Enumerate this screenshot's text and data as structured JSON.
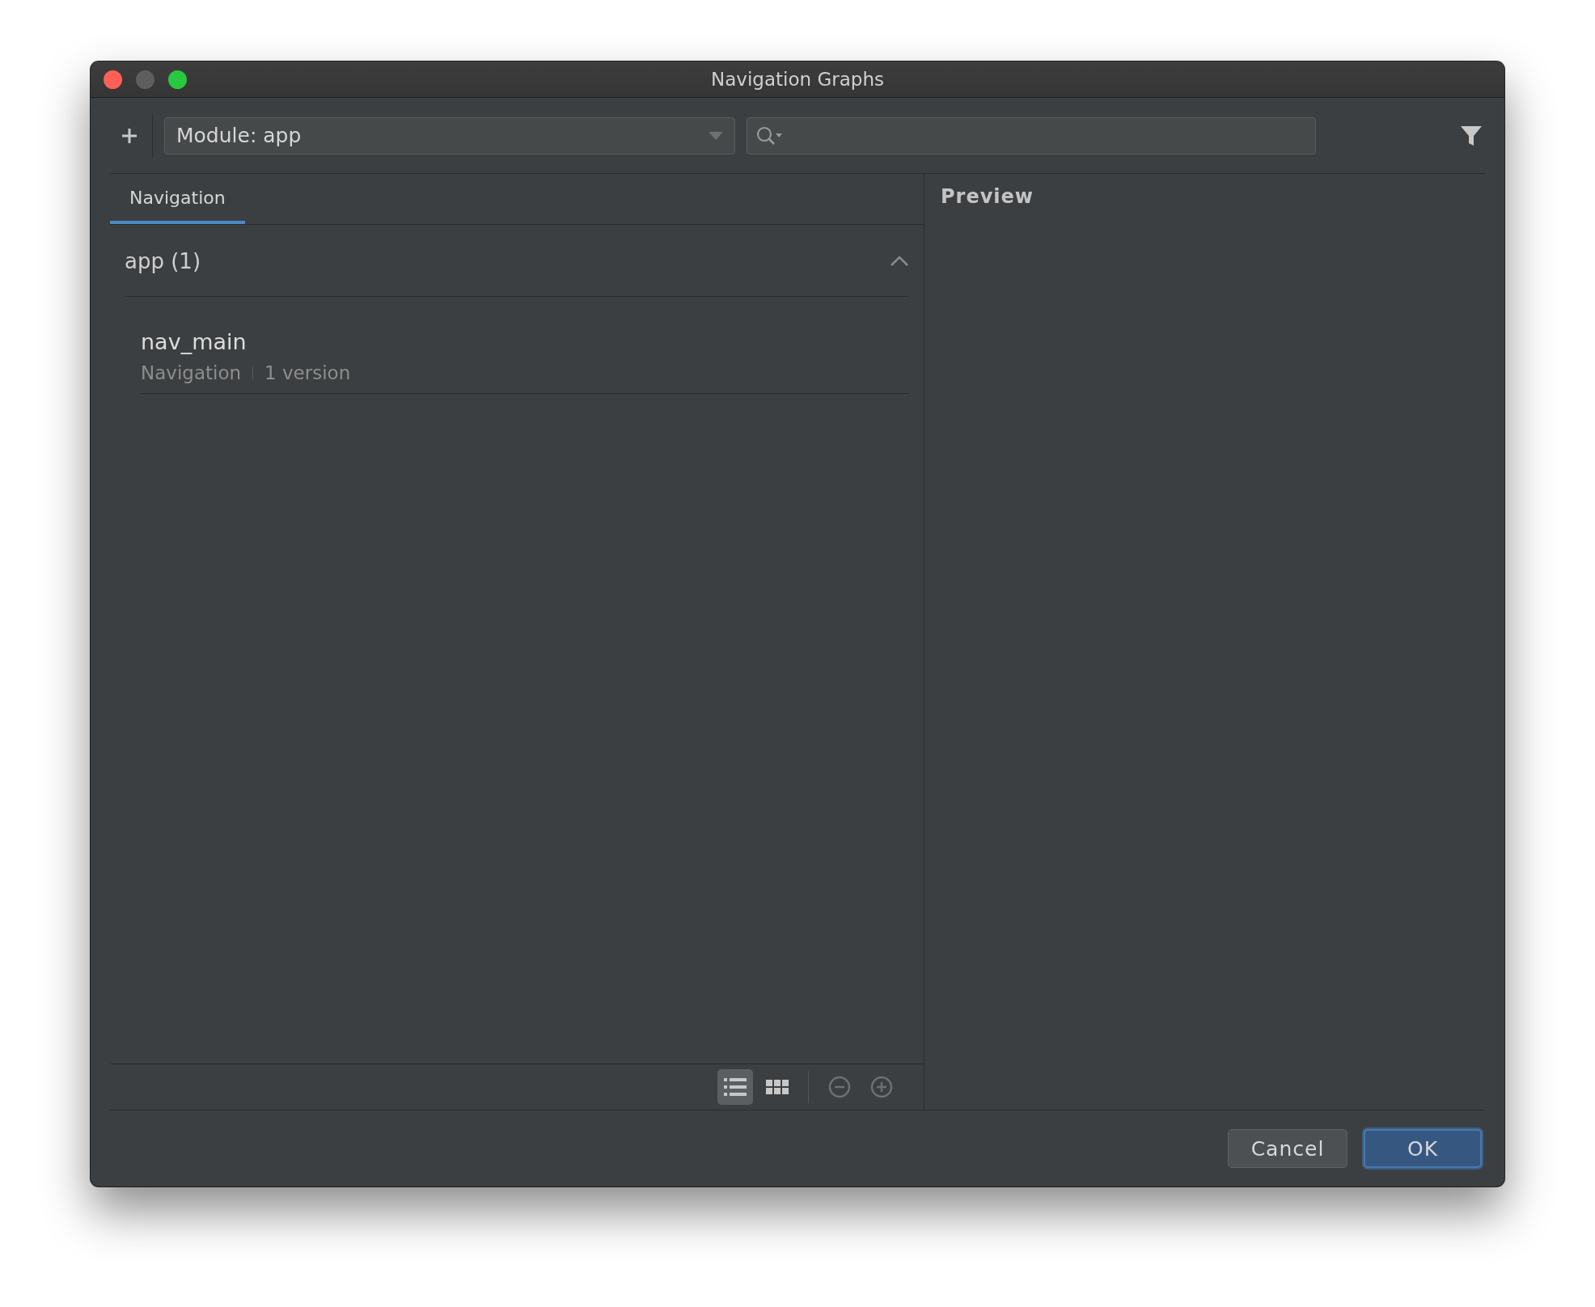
{
  "window": {
    "title": "Navigation Graphs"
  },
  "toolbar": {
    "module_select": {
      "value": "Module: app"
    }
  },
  "tabs": [
    {
      "label": "Navigation",
      "selected": true
    }
  ],
  "preview": {
    "title": "Preview"
  },
  "groups": [
    {
      "label": "app (1)",
      "expanded": true,
      "items": [
        {
          "name": "nav_main",
          "type": "Navigation",
          "versions": "1 version"
        }
      ]
    }
  ],
  "view_modes": [
    {
      "kind": "list",
      "selected": true
    },
    {
      "kind": "grid",
      "selected": false
    }
  ],
  "zoom_controls": [
    {
      "kind": "zoom-out",
      "disabled": true
    },
    {
      "kind": "zoom-in",
      "disabled": true
    }
  ],
  "buttons": [
    {
      "label": "Cancel",
      "primary": false
    },
    {
      "label": "OK",
      "primary": true
    }
  ]
}
